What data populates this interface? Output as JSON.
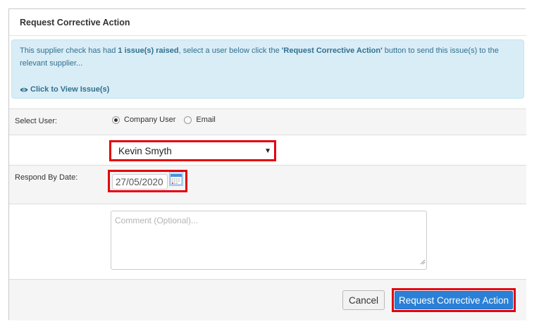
{
  "modal": {
    "title": "Request Corrective Action"
  },
  "alert": {
    "text_before": "This supplier check has had ",
    "issues_bold": "1 issue(s) raised",
    "text_middle": ", select a user below click the ",
    "button_ref_bold": "'Request Corrective Action'",
    "text_after": " button to send this issue(s) to the relevant supplier...",
    "view_link_label": "Click to View Issue(s)",
    "view_link_icon": "eye-icon"
  },
  "form": {
    "select_user": {
      "label": "Select User:",
      "options": [
        {
          "label": "Company User",
          "selected": true
        },
        {
          "label": "Email",
          "selected": false
        }
      ]
    },
    "user_dropdown": {
      "value": "Kevin Smyth",
      "caret": "▼"
    },
    "respond_by": {
      "label": "Respond By Date:",
      "value": "27/05/2020",
      "icon": "calendar-icon"
    },
    "comment": {
      "placeholder": "Comment (Optional)...",
      "value": ""
    }
  },
  "footer": {
    "cancel_label": "Cancel",
    "submit_label": "Request Corrective Action"
  },
  "colors": {
    "alert_bg": "#d9edf7",
    "alert_text": "#31708f",
    "primary": "#2a80d6",
    "highlight": "#e3000f"
  }
}
